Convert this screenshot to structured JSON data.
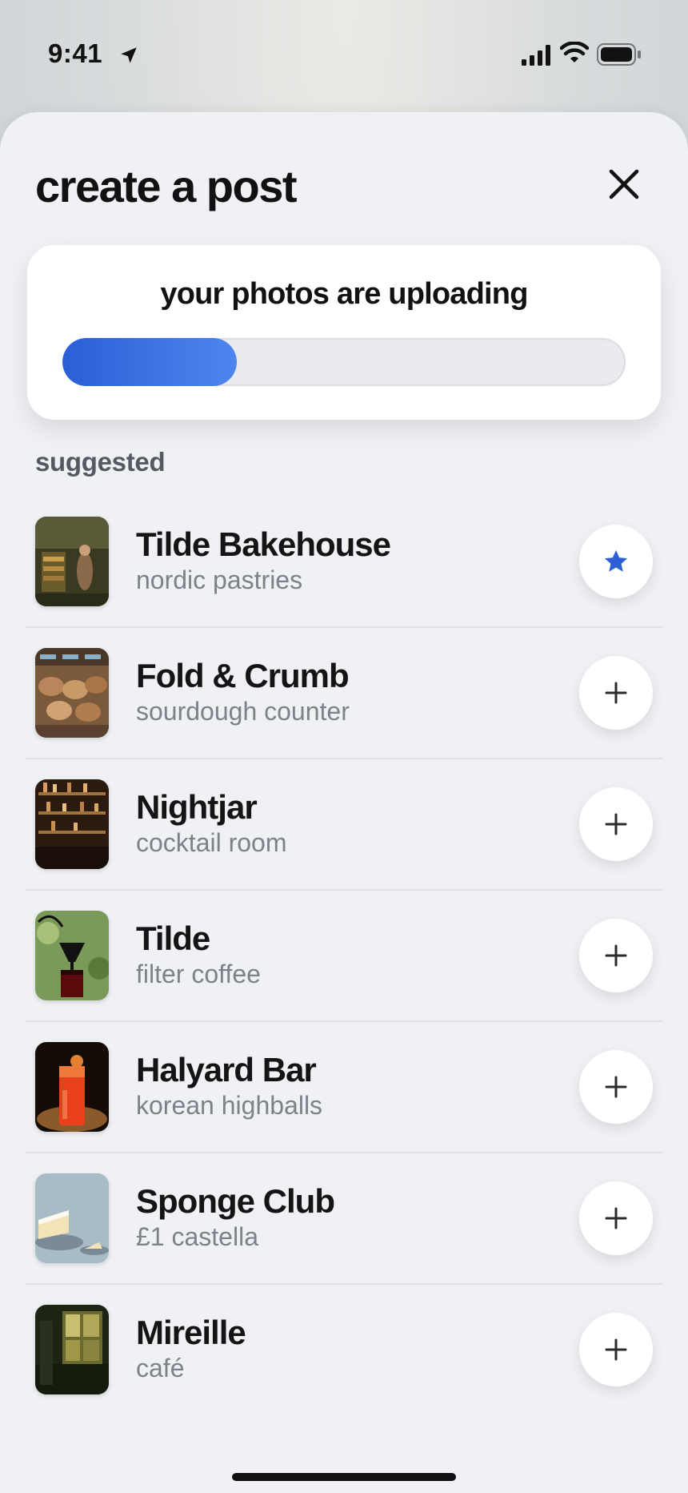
{
  "status_bar": {
    "time": "9:41"
  },
  "header": {
    "title": "create a post"
  },
  "upload": {
    "message": "your photos are uploading",
    "progress_percent": 31
  },
  "section": {
    "label": "suggested"
  },
  "places": [
    {
      "name": "Tilde Bakehouse",
      "subtitle": "nordic pastries",
      "action": "star-icon",
      "selected": true
    },
    {
      "name": "Fold & Crumb",
      "subtitle": "sourdough counter",
      "action": "plus-icon",
      "selected": false
    },
    {
      "name": "Nightjar",
      "subtitle": "cocktail room",
      "action": "plus-icon",
      "selected": false
    },
    {
      "name": "Tilde",
      "subtitle": "filter coffee",
      "action": "plus-icon",
      "selected": false
    },
    {
      "name": "Halyard Bar",
      "subtitle": "korean highballs",
      "action": "plus-icon",
      "selected": false
    },
    {
      "name": "Sponge Club",
      "subtitle": "£1 castella",
      "action": "plus-icon",
      "selected": false
    },
    {
      "name": "Mireille",
      "subtitle": "café",
      "action": "plus-icon",
      "selected": false
    }
  ],
  "colors": {
    "accent": "#2c5fd4",
    "text": "#111111",
    "subtle": "#7d828a",
    "sheet": "#eff1f4"
  }
}
